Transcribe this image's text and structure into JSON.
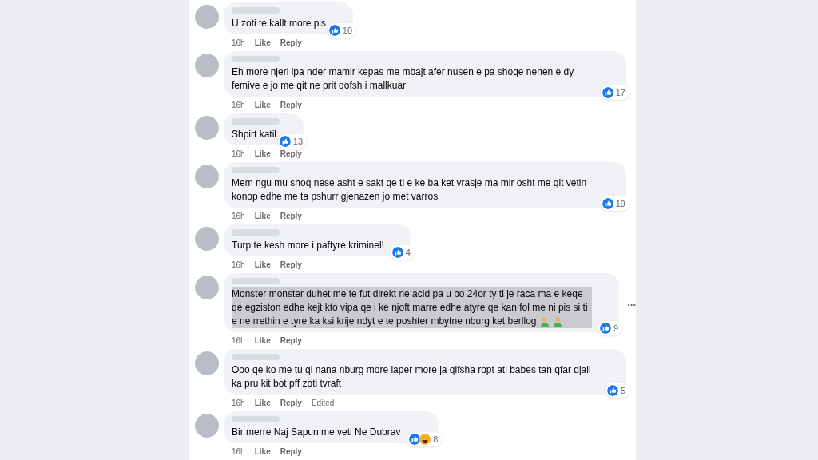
{
  "comments": [
    {
      "text": "U zoti te kallt more pis",
      "time": "16h",
      "like": "Like",
      "reply": "Reply",
      "reactions": [
        {
          "kind": "like"
        }
      ],
      "count": "10",
      "highlighted": false
    },
    {
      "text": "Eh more njeri ipa nder mamir kepas me mbajt afer nusen e pa shoqe nenen e dy femive e jo me qit ne prit qofsh i mallkuar",
      "time": "16h",
      "like": "Like",
      "reply": "Reply",
      "reactions": [
        {
          "kind": "like"
        }
      ],
      "count": "17",
      "highlighted": false
    },
    {
      "text": "Shpirt katil",
      "time": "16h",
      "like": "Like",
      "reply": "Reply",
      "reactions": [
        {
          "kind": "like"
        }
      ],
      "count": "13",
      "highlighted": false
    },
    {
      "text": "Mem ngu mu shoq nese asht e sakt qe ti e ke ba ket vrasje ma mir osht me qit vetin konop edhe me ta pshurr gjenazen jo met varros",
      "time": "16h",
      "like": "Like",
      "reply": "Reply",
      "reactions": [
        {
          "kind": "like"
        }
      ],
      "count": "19",
      "highlighted": false
    },
    {
      "text": "Turp te kesh more i paftyre kriminel!",
      "time": "16h",
      "like": "Like",
      "reply": "Reply",
      "reactions": [
        {
          "kind": "like"
        }
      ],
      "count": "4",
      "highlighted": false
    },
    {
      "text": "Monster monster duhet me te fut direkt ne acid pa u bo 24or ty ti je raca ma e keqe qe egziston edhe kejt kto vipa qe i ke njoft marre edhe atyre qe kan fol me ni pis si ti e ne rrethin e tyre ka ksi krije ndyt e te poshter mbytne nburg ket berllog",
      "emoji": [
        {
          "kind": "person"
        },
        {
          "kind": "person"
        }
      ],
      "time": "16h",
      "like": "Like",
      "reply": "Reply",
      "reactions": [
        {
          "kind": "like"
        }
      ],
      "count": "9",
      "highlighted": true,
      "more": "..."
    },
    {
      "text": "Ooo qe ko me tu qi nana nburg more laper more ja qifsha ropt ati babes tan qfar djali ka pru kit bot pff zoti tvraft",
      "time": "16h",
      "like": "Like",
      "reply": "Reply",
      "edited": "Edited",
      "reactions": [
        {
          "kind": "like"
        }
      ],
      "count": "5",
      "highlighted": false
    },
    {
      "text": "Bir merre Naj Sapun me veti Ne Dubrav",
      "time": "16h",
      "like": "Like",
      "reply": "Reply",
      "reactions": [
        {
          "kind": "like"
        },
        {
          "kind": "haha"
        }
      ],
      "count": "8",
      "highlighted": false
    }
  ]
}
